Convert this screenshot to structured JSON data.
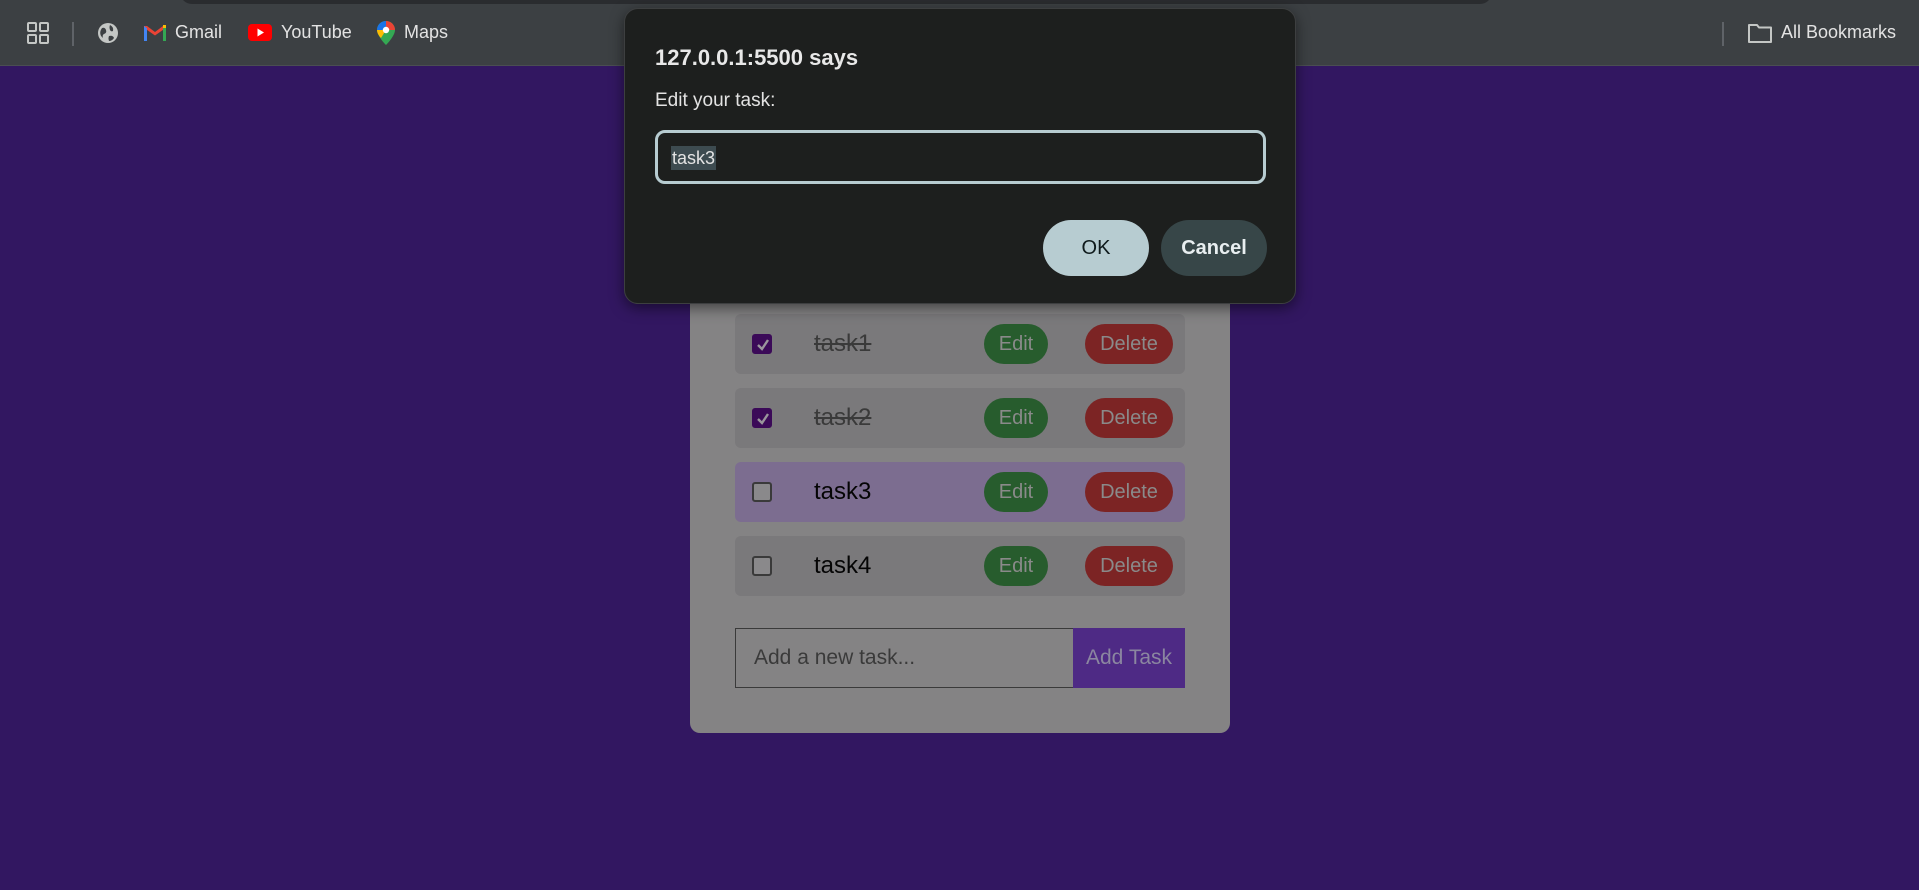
{
  "bookmarks_bar": {
    "items": [
      {
        "label": "Gmail",
        "icon": "gmail-icon"
      },
      {
        "label": "YouTube",
        "icon": "youtube-icon"
      },
      {
        "label": "Maps",
        "icon": "maps-icon"
      }
    ],
    "all_bookmarks": {
      "label": "All Bookmarks",
      "icon": "folder-icon"
    }
  },
  "dialog": {
    "title": "127.0.0.1:5500 says",
    "message": "Edit your task:",
    "input_value": "task3",
    "ok_label": "OK",
    "cancel_label": "Cancel"
  },
  "todo": {
    "tasks": [
      {
        "text": "task1",
        "completed": true
      },
      {
        "text": "task2",
        "completed": true
      },
      {
        "text": "task3",
        "completed": false
      },
      {
        "text": "task4",
        "completed": false
      }
    ],
    "edit_label": "Edit",
    "delete_label": "Delete",
    "new_task_placeholder": "Add a new task...",
    "add_button_label": "Add Task"
  },
  "colors": {
    "page_background": "#321761",
    "edit_button": "#275c2d",
    "delete_button": "#7c2424",
    "add_button": "#4e2a85",
    "dialog_accent": "#b7ccd1"
  }
}
